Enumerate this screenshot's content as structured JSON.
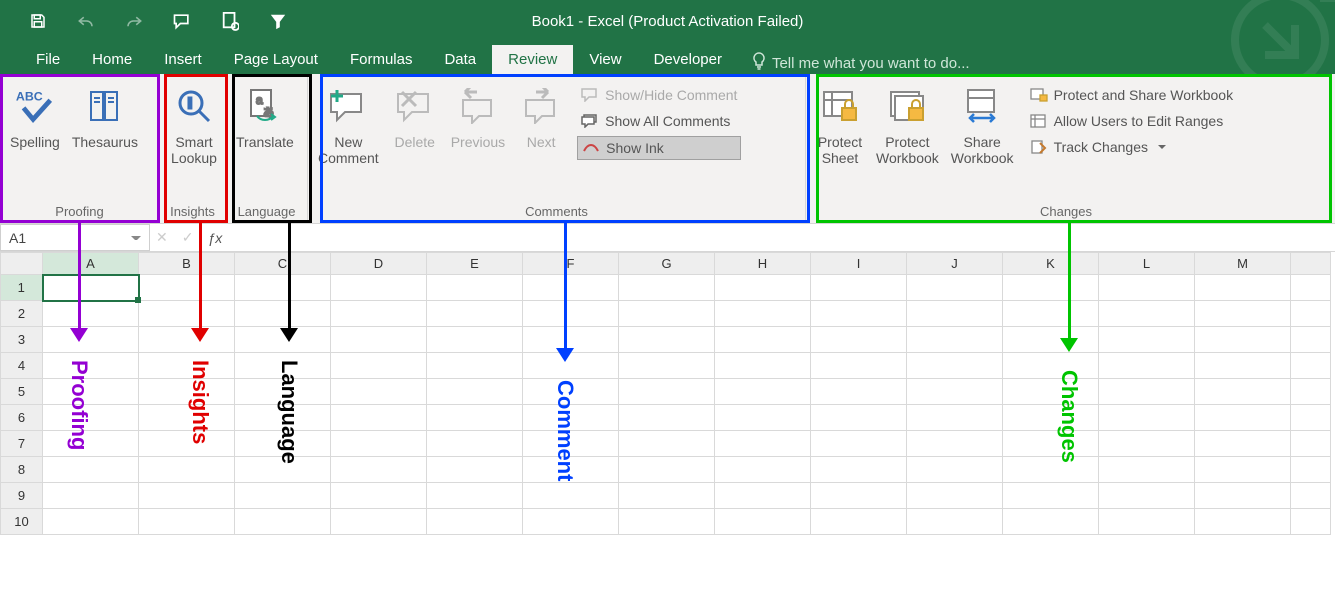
{
  "title": "Book1 - Excel (Product Activation Failed)",
  "tabs": [
    "File",
    "Home",
    "Insert",
    "Page Layout",
    "Formulas",
    "Data",
    "Review",
    "View",
    "Developer"
  ],
  "active_tab": "Review",
  "tellme_placeholder": "Tell me what you want to do...",
  "ribbon": {
    "proofing": {
      "label": "Proofing",
      "spelling": "Spelling",
      "thesaurus": "Thesaurus"
    },
    "insights": {
      "label": "Insights",
      "smart_lookup": "Smart\nLookup"
    },
    "language": {
      "label": "Language",
      "translate": "Translate"
    },
    "comments": {
      "label": "Comments",
      "new": "New\nComment",
      "delete": "Delete",
      "prev": "Previous",
      "next": "Next",
      "showhide": "Show/Hide Comment",
      "showall": "Show All Comments",
      "showink": "Show Ink"
    },
    "changes": {
      "label": "Changes",
      "protect_sheet": "Protect\nSheet",
      "protect_wb": "Protect\nWorkbook",
      "share_wb": "Share\nWorkbook",
      "protect_share": "Protect and Share Workbook",
      "allow_edit": "Allow Users to Edit Ranges",
      "track": "Track Changes"
    }
  },
  "namebox": "A1",
  "columns": [
    "A",
    "B",
    "C",
    "D",
    "E",
    "F",
    "G",
    "H",
    "I",
    "J",
    "K",
    "L",
    "M"
  ],
  "rows": [
    1,
    2,
    3,
    4,
    5,
    6,
    7,
    8,
    9,
    10
  ],
  "annotations": {
    "proofing": "Proofing",
    "insights": "Insights",
    "language": "Language",
    "comment": "Comment",
    "changes": "Changes"
  }
}
